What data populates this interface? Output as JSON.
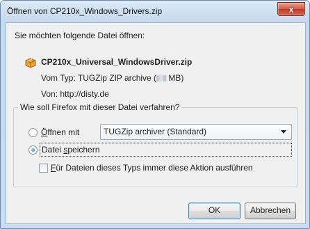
{
  "window": {
    "title": "Öffnen von CP210x_Windows_Drivers.zip",
    "close_label": "x"
  },
  "prompt": "Sie möchten folgende Datei öffnen:",
  "file": {
    "name": "CP210x_Universal_WindowsDriver.zip",
    "type_prefix": "Vom Typ:  TUGZip ZIP archive (",
    "type_suffix": " MB)",
    "from": "Von:  http://disty.de",
    "icon": "zip-archive-icon"
  },
  "action_group": {
    "legend": "Wie soll Firefox mit dieser Datei verfahren?",
    "open_with": {
      "accel": "Ö",
      "rest": "ffnen mit",
      "selected": false,
      "app": "TUGZip archiver (Standard)"
    },
    "save": {
      "pre": "Datei ",
      "accel": "s",
      "rest": "peichern",
      "selected": true
    },
    "always": {
      "accel": "F",
      "rest": "ür Dateien dieses Typs immer diese Aktion ausführen",
      "checked": false
    }
  },
  "buttons": {
    "ok": "OK",
    "cancel": "Abbrechen"
  }
}
